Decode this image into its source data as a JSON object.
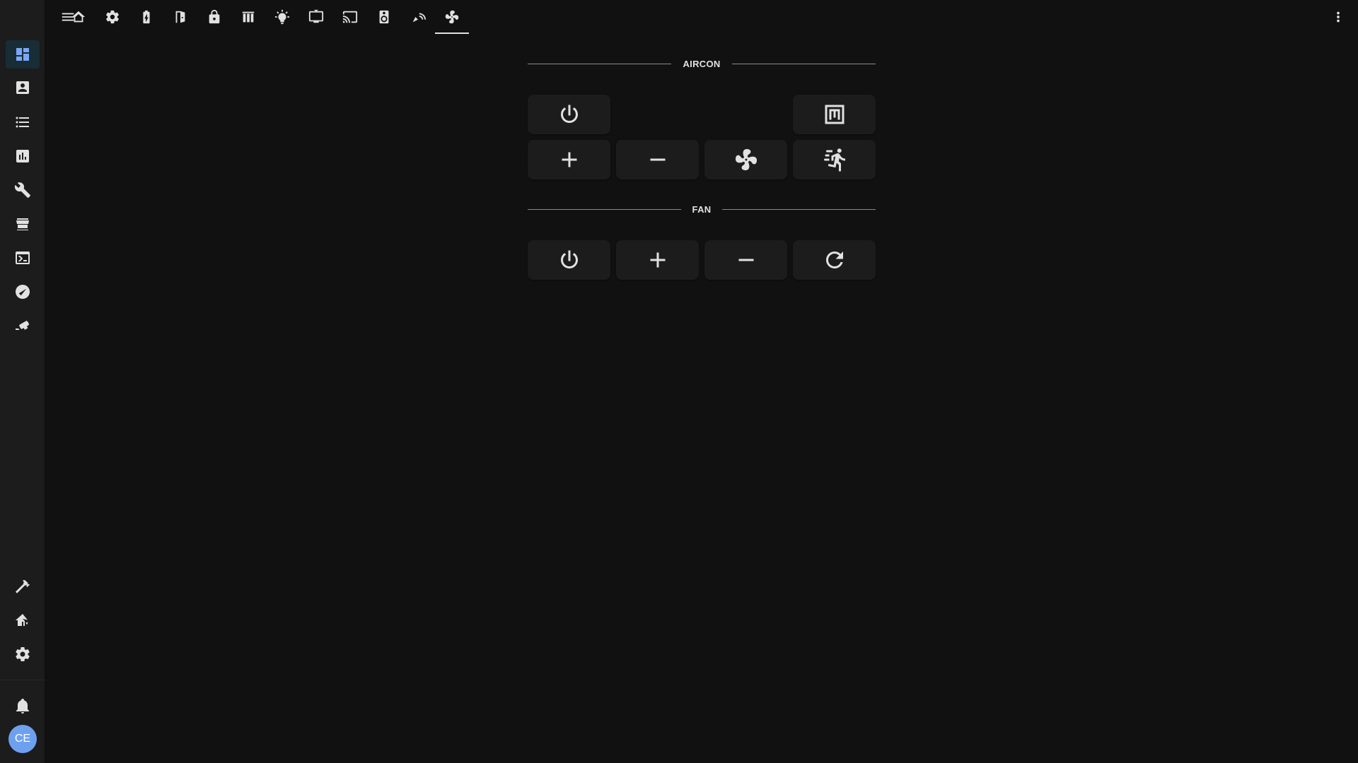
{
  "topbar": {
    "tabs": [
      {
        "icon": "home-icon"
      },
      {
        "icon": "gear-icon"
      },
      {
        "icon": "battery-charging-icon"
      },
      {
        "icon": "door-icon"
      },
      {
        "icon": "lock-icon"
      },
      {
        "icon": "blinds-icon"
      },
      {
        "icon": "lightbulb-icon"
      },
      {
        "icon": "television-icon"
      },
      {
        "icon": "cast-icon"
      },
      {
        "icon": "speaker-icon"
      },
      {
        "icon": "signal-icon"
      },
      {
        "icon": "fan-icon",
        "active": true
      }
    ]
  },
  "sidebar": {
    "items": [
      {
        "icon": "dashboard-icon",
        "active": true
      },
      {
        "icon": "account-box-icon"
      },
      {
        "icon": "list-icon"
      },
      {
        "icon": "chart-icon"
      },
      {
        "icon": "wrench-icon"
      },
      {
        "icon": "hacs-store-icon"
      },
      {
        "icon": "terminal-icon"
      },
      {
        "icon": "compass-icon"
      },
      {
        "icon": "cctv-icon"
      }
    ],
    "bottom_items": [
      {
        "icon": "hammer-icon"
      },
      {
        "icon": "home-gear-icon"
      },
      {
        "icon": "settings-icon"
      }
    ],
    "avatar_initials": "CE"
  },
  "aircon": {
    "title": "AIRCON",
    "buttons": [
      "power-icon",
      "mode-icon",
      "plus-icon",
      "minus-icon",
      "fan-icon",
      "run-fast-icon"
    ]
  },
  "fan": {
    "title": "FAN",
    "buttons": [
      "power-icon",
      "plus-icon",
      "minus-icon",
      "rotate-icon"
    ]
  },
  "colors": {
    "background": "#111111",
    "sidebar": "#1c1c1c",
    "button": "#1c1c1c",
    "accent": "#7aa8f7",
    "avatar": "#6ea0f0"
  }
}
